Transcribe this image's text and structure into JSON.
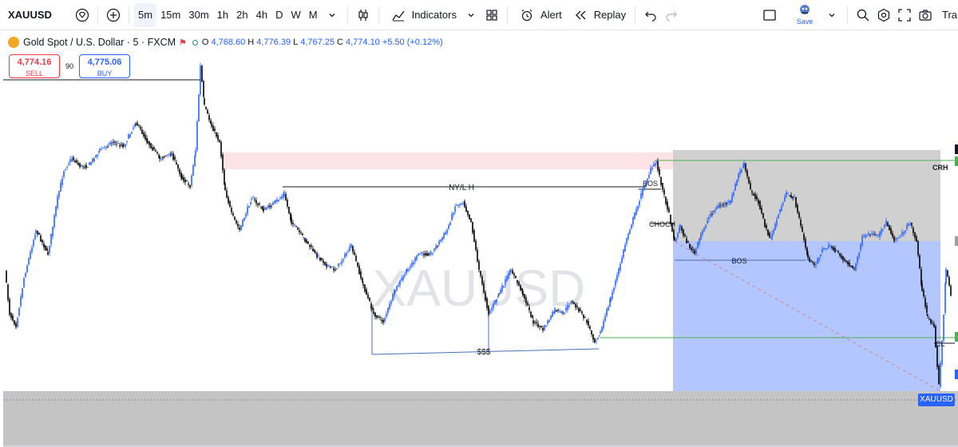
{
  "toolbar": {
    "symbol": "XAUUSD",
    "timeframes": [
      "5m",
      "15m",
      "30m",
      "1h",
      "2h",
      "4h",
      "D",
      "W",
      "M"
    ],
    "active_timeframe": "5m",
    "indicators_label": "Indicators",
    "alert_label": "Alert",
    "replay_label": "Replay",
    "save_label": "Save",
    "trade_label": "Tra"
  },
  "legend": {
    "title": "Gold Spot / U.S. Dollar · 5 · FXCM",
    "open_label": "O",
    "open": "4,768.60",
    "high_label": "H",
    "high": "4,776.39",
    "low_label": "L",
    "low": "4,767.25",
    "close_label": "C",
    "close": "4,774.10",
    "change": "+5.50 (+0.12%)"
  },
  "order": {
    "sell_price": "4,774.16",
    "sell_label": "SELL",
    "spread": "90",
    "buy_price": "4,775.06",
    "buy_label": "BUY"
  },
  "watermark": "XAUUSD",
  "annotations": {
    "ny_lh": "NY/L H",
    "sss": "$$$",
    "bos_top": "BOS",
    "choch": "CHOCH",
    "bos_mid": "BOS",
    "crh": "CRH",
    "cl": "CL"
  },
  "price_tag": "XAUUSD",
  "colors": {
    "bull": "#2962ff",
    "bear": "#000000",
    "premium_zone": "#fbe3e6",
    "gray_zone": "#d0d0d0",
    "blue_zone": "#b3c6ff",
    "green_line": "#4caf50",
    "accent": "#2962ff"
  }
}
